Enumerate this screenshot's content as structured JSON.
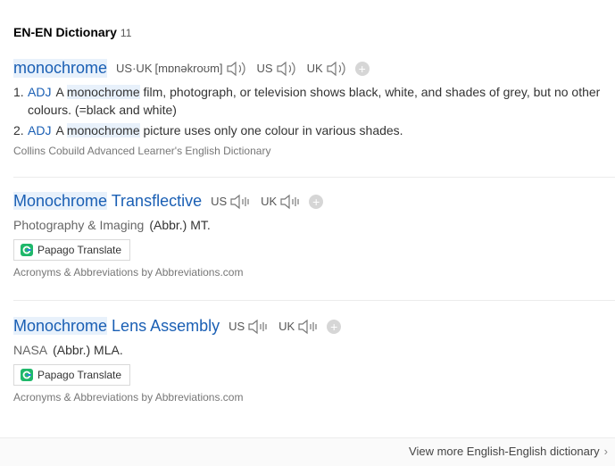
{
  "header": {
    "title": "EN-EN Dictionary",
    "count": "11"
  },
  "entries": [
    {
      "headword": "monochrome",
      "pron_label": "US·UK",
      "ipa": "[mɒnəkroʊm]",
      "us_label": "US",
      "uk_label": "UK",
      "definitions": [
        {
          "num": "1.",
          "pos": "ADJ",
          "pre": "A ",
          "hl": "monochrome",
          "post": " film, photograph, or television shows black, white, and shades of grey, but no other colours. (=black and white)"
        },
        {
          "num": "2.",
          "pos": "ADJ",
          "pre": "A ",
          "hl": "monochrome",
          "post": " picture uses only one colour in various shades."
        }
      ],
      "source": "Collins Cobuild Advanced Learner's English Dictionary"
    },
    {
      "headword_hl": "Monochrome",
      "headword_rest": " Transflective",
      "us_label": "US",
      "uk_label": "UK",
      "category": "Photography & Imaging",
      "abbr": "(Abbr.) MT.",
      "translate": "Papago Translate",
      "source": "Acronyms & Abbreviations by Abbreviations.com"
    },
    {
      "headword_hl": "Monochrome",
      "headword_rest": " Lens Assembly",
      "us_label": "US",
      "uk_label": "UK",
      "category": "NASA",
      "abbr": "(Abbr.) MLA.",
      "translate": "Papago Translate",
      "source": "Acronyms & Abbreviations by Abbreviations.com"
    }
  ],
  "footer": {
    "more": "View more English-English dictionary"
  },
  "colors": {
    "link": "#1a5fb4",
    "highlight": "#e8f1fb",
    "papago_green": "#1fb86a",
    "papago_blue": "#2b7fd6"
  },
  "icons": {
    "speaker": "speaker-icon",
    "add": "plus-icon",
    "chevron": "chevron-right-icon",
    "papago": "papago-logo-icon"
  }
}
